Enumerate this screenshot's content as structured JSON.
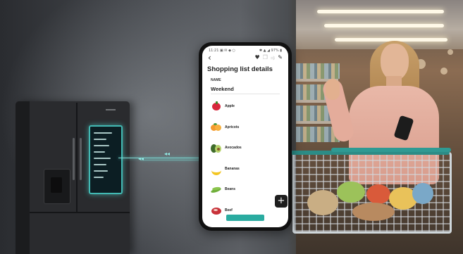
{
  "phone": {
    "status_left": "11:21 ▣ ✉ ◆ ○",
    "status_right": "✱ ▲ ◢ 97% ▮",
    "back_icon": "chevron-left-icon",
    "actions": [
      "heart-icon",
      "copy-icon",
      "share-icon",
      "edit-icon"
    ],
    "title": "Shopping list details",
    "name_label": "NAME",
    "name_value": "Weekend",
    "items": [
      {
        "label": "Apple",
        "icon": "apple-icon"
      },
      {
        "label": "Apricots",
        "icon": "apricot-icon"
      },
      {
        "label": "Avocados",
        "icon": "avocado-icon"
      },
      {
        "label": "Bananas",
        "icon": "banana-icon"
      },
      {
        "label": "Beans",
        "icon": "beans-icon"
      },
      {
        "label": "Beef",
        "icon": "beef-icon"
      }
    ],
    "bottom_button": "",
    "fab": "+"
  },
  "colors": {
    "accent": "#2aaba0",
    "connector": "#7fd9d4",
    "fridge_body": "#2a2b2e"
  }
}
